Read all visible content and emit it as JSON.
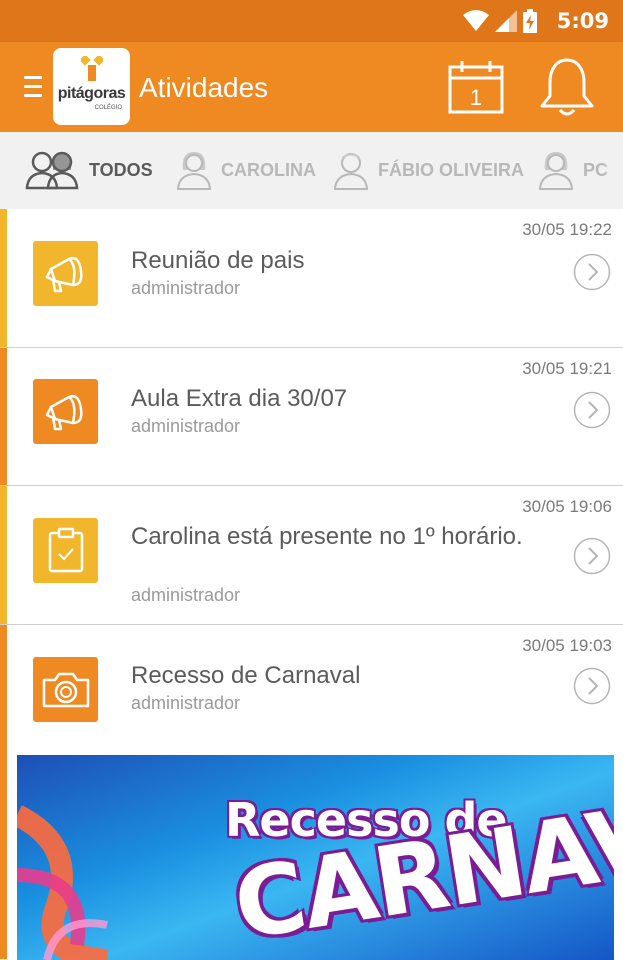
{
  "status": {
    "time": "5:09"
  },
  "appbar": {
    "title": "Atividades",
    "logo_text": "pitágoras",
    "logo_sub": "COLÉGIO",
    "calendar_day": "1"
  },
  "filters": [
    {
      "label": "TODOS",
      "active": true
    },
    {
      "label": "CAROLINA",
      "active": false
    },
    {
      "label": "FÁBIO OLIVEIRA",
      "active": false
    },
    {
      "label": "PC",
      "active": false
    }
  ],
  "feed": [
    {
      "title": "Reunião de pais",
      "author": "administrador",
      "time": "30/05 19:22",
      "icon": "megaphone-icon",
      "color": "#f2b62c"
    },
    {
      "title": "Aula Extra dia 30/07",
      "author": "administrador",
      "time": "30/05 19:21",
      "icon": "megaphone-icon",
      "color": "#ef8a23"
    },
    {
      "title": "Carolina está presente no 1º horário.",
      "author": "administrador",
      "time": "30/05 19:06",
      "icon": "clipboard-check-icon",
      "color": "#f2b62c"
    },
    {
      "title": "Recesso de Carnaval",
      "author": "administrador",
      "time": "30/05 19:03",
      "icon": "camera-icon",
      "color": "#ef8a23"
    }
  ],
  "banner": {
    "line1": "Recesso de",
    "line2": "CARNAVAL"
  },
  "colors": {
    "primary": "#ef8a23",
    "status_bar": "#e0761a",
    "yellow": "#f2b62c"
  }
}
